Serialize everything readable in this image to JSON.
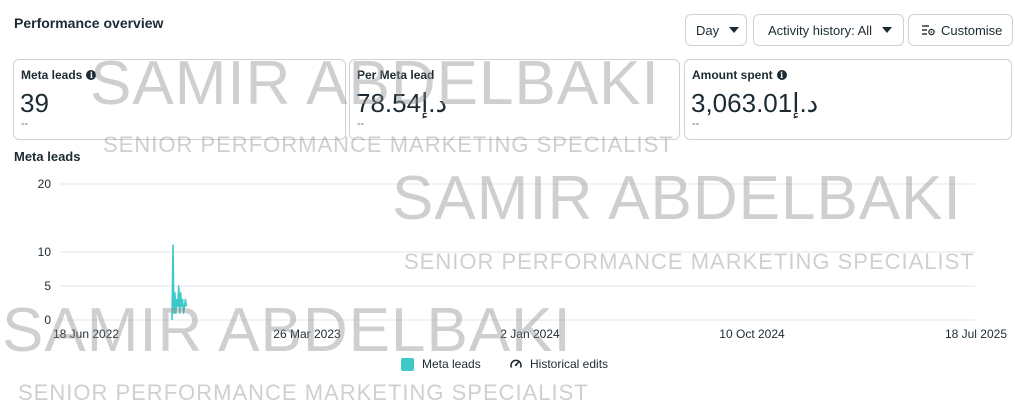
{
  "header": {
    "title": "Performance overview",
    "day_label": "Day",
    "activity_label": "Activity history: All",
    "customise_label": "Customise"
  },
  "metrics": [
    {
      "label": "Meta leads",
      "value": "39",
      "compare": "--",
      "has_info": true
    },
    {
      "label": "Per Meta lead",
      "value": "78.54د.إ",
      "compare": "--",
      "has_info": false
    },
    {
      "label": "Amount spent",
      "value": "3,063.01د.إ",
      "compare": "--",
      "has_info": true
    }
  ],
  "chart_data": {
    "type": "line",
    "title": "Meta leads",
    "y_ticks": [
      0,
      5,
      10,
      20
    ],
    "ylim": [
      0,
      20
    ],
    "x_tick_labels": [
      "18 Jun 2022",
      "26 Mar 2023",
      "2 Jan 2024",
      "10 Oct 2024",
      "18 Jul 2025"
    ],
    "series": [
      {
        "name": "Meta leads",
        "color": "#3ec9c9",
        "x_index": [
          0,
          0.6,
          1.2,
          1.8,
          2.4,
          3.0,
          3.6,
          4.2,
          4.8,
          5.4,
          6.0,
          6.6,
          7.2,
          7.8,
          8.4,
          9.0
        ],
        "values": [
          0,
          11,
          1,
          4,
          1,
          3,
          2,
          5,
          1,
          4,
          2,
          3,
          1,
          2,
          3,
          2
        ]
      }
    ],
    "legend": [
      "Meta leads",
      "Historical edits"
    ],
    "grid": true
  },
  "watermark": {
    "name": "SAMIR ABDELBAKI",
    "role": "SENIOR PERFORMANCE MARKETING SPECIALIST"
  }
}
